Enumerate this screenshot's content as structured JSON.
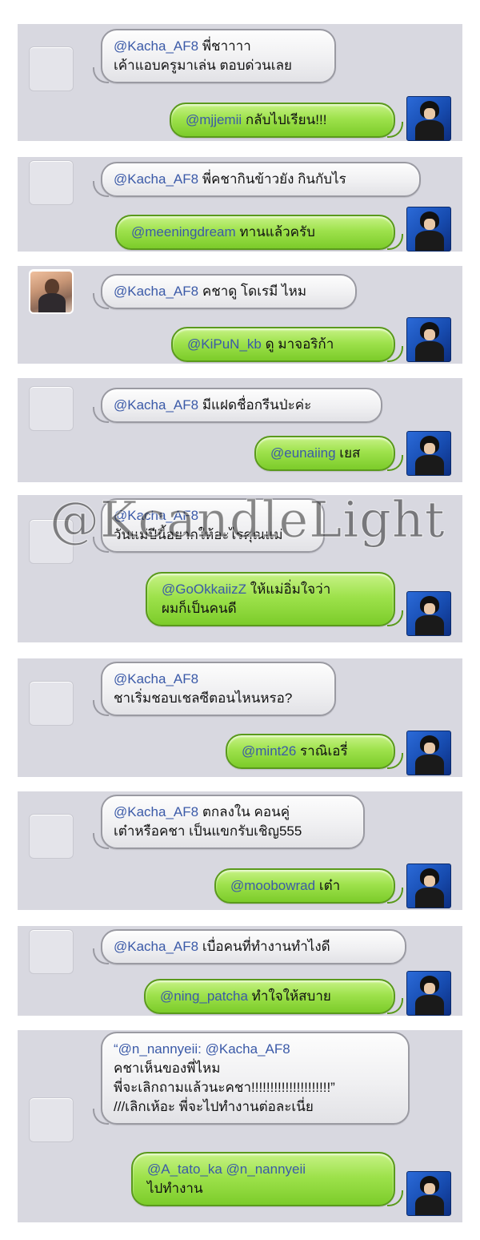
{
  "watermark": "@KcandleLight",
  "threads": [
    {
      "question_mention": "@Kacha_AF8",
      "question_text": "พี่ชาาาา",
      "question_line2": "เค้าแอบครูมาเล่น ตอบด่วนเลย",
      "reply_mention": "@mjjemii",
      "reply_text": "กลับไปเรียน!!!"
    },
    {
      "question_mention": "@Kacha_AF8",
      "question_text": "พี่คชากินข้าวยัง กินกับไร",
      "reply_mention": "@meeningdream",
      "reply_text": "ทานแล้วครับ"
    },
    {
      "question_mention": "@Kacha_AF8",
      "question_text": "คชาดู โดเรมี ไหม",
      "reply_mention": "@KiPuN_kb",
      "reply_text": "ดู มาจอริก้า"
    },
    {
      "question_mention": "@Kacha_AF8",
      "question_text": "มีแฝดชื่อกรีนป่ะค่ะ",
      "reply_mention": "@eunaiing",
      "reply_text": "เยส"
    },
    {
      "question_mention": "@Kacha_AF8",
      "question_line2": "วันแม่ปีนี้อยากให้อะไรคุณแม่",
      "reply_mention": "@GoOkkaiizZ",
      "reply_text": "ให้แม่อิ่มใจว่า",
      "reply_line2": "ผมก็เป็นคนดี"
    },
    {
      "question_mention": "@Kacha_AF8",
      "question_line2": "ชาเริ่มชอบเชลซีตอนไหนหรอ?",
      "reply_mention": "@mint26",
      "reply_text": "ราณิเอรี่"
    },
    {
      "question_mention": "@Kacha_AF8",
      "question_text": "ตกลงใน คอนคู่",
      "question_line2": "เต๋าหรือคชา เป็นแขกรับเชิญ555",
      "reply_mention": "@moobowrad",
      "reply_text": "เต๋า"
    },
    {
      "question_mention": "@Kacha_AF8",
      "question_text": "เบื่อคนที่ทำงานทำไงดี",
      "reply_mention": "@ning_patcha",
      "reply_text": "ทำใจให้สบาย"
    },
    {
      "question_mention": "“@n_nannyeii: @Kacha_AF8",
      "question_line2": "คชาเห็นของพี่ไหม",
      "question_line3": "พี่จะเลิกถามแล้วนะคชา!!!!!!!!!!!!!!!!!!!!!”",
      "question_line4": "///เลิกเห้อะ พี่จะไปทำงานต่อละเนี่ย",
      "reply_mention": "@A_tato_ka @n_nannyeii",
      "reply_line2": "ไปทำงาน"
    }
  ]
}
